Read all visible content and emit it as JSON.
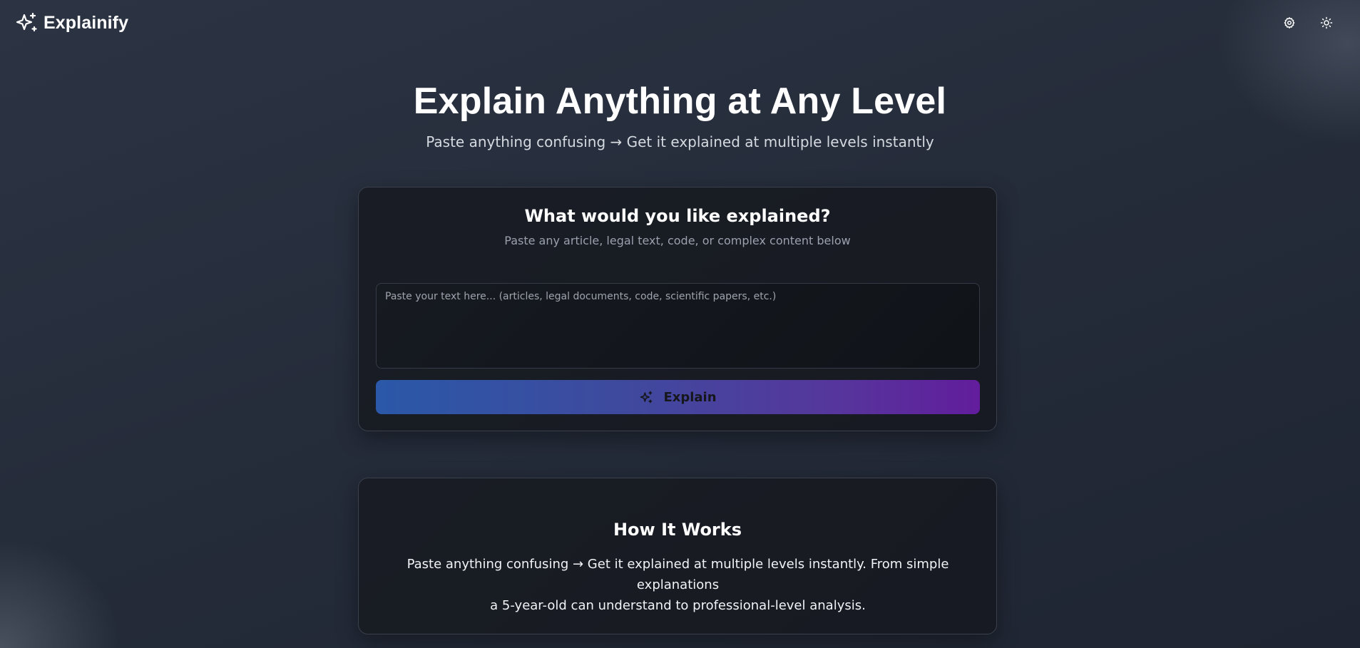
{
  "app": {
    "name": "Explainify",
    "logo_icon": "sparkles-icon"
  },
  "header": {
    "settings_icon": "gear-icon",
    "theme_icon": "sun-icon"
  },
  "hero": {
    "title": "Explain Anything at Any Level",
    "subtitle": "Paste anything confusing → Get it explained at multiple levels instantly"
  },
  "input_card": {
    "title": "What would you like explained?",
    "subtitle": "Paste any article, legal text, code, or complex content below",
    "textarea_placeholder": "Paste your text here... (articles, legal documents, code, scientific papers, etc.)",
    "textarea_value": "",
    "button_label": "Explain",
    "button_icon": "sparkles-icon"
  },
  "how_card": {
    "title": "How It Works",
    "body_line1": "Paste anything confusing → Get it explained at multiple levels instantly. From simple explanations",
    "body_line2": "a 5-year-old can understand to professional-level analysis."
  },
  "colors": {
    "background": "#262d3b",
    "card": "#181b22",
    "button_gradient_start": "#2b58a8",
    "button_gradient_end": "#621d9c",
    "text_primary": "#ffffff",
    "text_muted": "#9aa1ad"
  }
}
